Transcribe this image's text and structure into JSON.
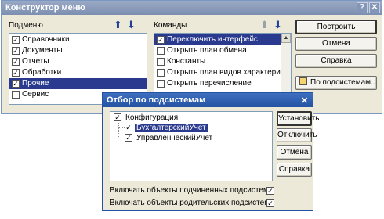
{
  "main_window": {
    "title": "Конструктор меню",
    "title_buttons": {
      "help": "?",
      "close": "✕"
    },
    "subsystems_label": "Подменю",
    "commands_label": "Команды",
    "subsystems": [
      {
        "label": "Справочники",
        "checked": true,
        "selected": false
      },
      {
        "label": "Документы",
        "checked": true,
        "selected": false
      },
      {
        "label": "Отчеты",
        "checked": true,
        "selected": false
      },
      {
        "label": "Обработки",
        "checked": true,
        "selected": false
      },
      {
        "label": "Прочие",
        "checked": true,
        "selected": true
      },
      {
        "label": "Сервис",
        "checked": false,
        "selected": false
      }
    ],
    "commands": [
      {
        "label": "Переключить интерфейс",
        "checked": true,
        "selected": true
      },
      {
        "label": "Открыть план обмена",
        "checked": false,
        "selected": false
      },
      {
        "label": "Константы",
        "checked": false,
        "selected": false
      },
      {
        "label": "Открыть план видов характери...",
        "checked": false,
        "selected": false
      },
      {
        "label": "Открыть перечисление",
        "checked": false,
        "selected": false
      }
    ],
    "buttons": {
      "build": "Построить",
      "cancel": "Отмена",
      "help": "Справка",
      "by_subsystems": "По подсистемам..."
    },
    "arrows": {
      "up": "⬆",
      "down": "⬇"
    }
  },
  "dialog": {
    "title": "Отбор по подсистемам",
    "close": "✕",
    "tree": [
      {
        "label": "Конфигурация",
        "checked": true,
        "level": 0,
        "selected": false
      },
      {
        "label": "БухгалтерскийУчет",
        "checked": true,
        "level": 1,
        "selected": true
      },
      {
        "label": "УправленческийУчет",
        "checked": true,
        "level": 1,
        "selected": false
      }
    ],
    "buttons": {
      "set": "Установить",
      "reset": "Отключить",
      "cancel": "Отмена",
      "help": "Справка"
    },
    "options": [
      {
        "label": "Включать объекты подчиненных подсистем",
        "checked": true
      },
      {
        "label": "Включать объекты родительских подсистем",
        "checked": true
      }
    ]
  },
  "colors": {
    "selection": "#2a3a8f",
    "title_active": "#2552a3",
    "title_inactive": "#7d8fb1",
    "window_bg": "#ece9d8"
  }
}
